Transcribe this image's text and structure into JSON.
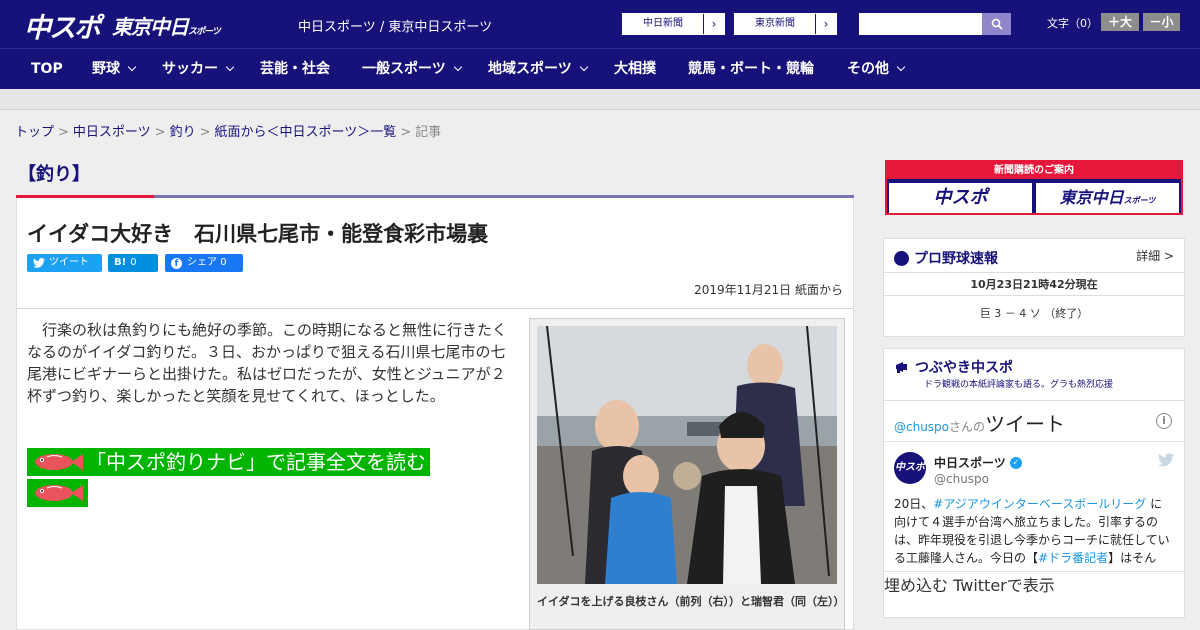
{
  "header": {
    "logo_chunichi_sports": "中スポ",
    "logo_tokyo_chunichi": "東京中日",
    "logo_tokyo_chunichi_sub": "スポーツ",
    "site_links": "中日スポーツ / 東京中日スポーツ",
    "paper_buttons": [
      {
        "label": "中日新聞",
        "arrow": "›"
      },
      {
        "label": "東京新聞",
        "arrow": "›"
      }
    ],
    "search_placeholder": "",
    "font_size_label": "文字（0）",
    "font_larger": "＋大",
    "font_smaller": "－小"
  },
  "nav": {
    "items": [
      {
        "label": "TOP",
        "dropdown": false
      },
      {
        "label": "野球",
        "dropdown": true
      },
      {
        "label": "サッカー",
        "dropdown": true
      },
      {
        "label": "芸能・社会",
        "dropdown": false
      },
      {
        "label": "一般スポーツ",
        "dropdown": true
      },
      {
        "label": "地域スポーツ",
        "dropdown": true
      },
      {
        "label": "大相撲",
        "dropdown": false
      },
      {
        "label": "競馬・ボート・競輪",
        "dropdown": false
      },
      {
        "label": "その他",
        "dropdown": true
      }
    ]
  },
  "breadcrumb": {
    "items": [
      "トップ",
      "中日スポーツ",
      "釣り",
      "紙面から＜中日スポーツ＞一覧",
      "記事"
    ],
    "separator": ">"
  },
  "category": "【釣り】",
  "article": {
    "title": "イイダコ大好き　石川県七尾市・能登食彩市場裏",
    "share": {
      "tweet": "ツイート",
      "hatena_icon": "B!",
      "hatena_count": "0",
      "facebook": "シェア",
      "facebook_count": "0"
    },
    "date": "2019年11月21日 紙面から",
    "body": "行楽の秋は魚釣りにも絶好の季節。この時期になると無性に行きたくなるのがイイダコ釣りだ。３日、おかっぱりで狙える石川県七尾市の七尾港にビギナーらと出掛けた。私はゼロだったが、女性とジュニアが２杯ずつ釣り、楽しかったと笑顔を見せてくれて、ほっとした。",
    "navi_link": "「中スポ釣りナビ」で記事全文を読む",
    "photo_caption": "イイダコを上げる良枝さん（前列（右））と瑞智君（同（左））"
  },
  "sidebar": {
    "ad": {
      "header": "新聞購読のご案内",
      "left": "中スポ",
      "right": "東京中日",
      "right_sub": "スポーツ"
    },
    "baseball": {
      "title": "プロ野球速報",
      "more": "詳細 >",
      "time": "10月23日21時42分現在",
      "score": "巨 3 － 4 ソ （終了）"
    },
    "twitter": {
      "title": "つぶやき中スポ",
      "subtitle": "ドラ観戦の本紙評論家も語る。グラも熱烈応援",
      "handle_at": "@chuspo",
      "handle_suffix": "さんの",
      "heading": "ツイート",
      "info": "i",
      "avatar_text": "中スポ",
      "name": "中日スポーツ",
      "user": "@chuspo",
      "tweet_pre": "20日、",
      "tweet_tag1": "#アジアウインターベースボールリーグ",
      "tweet_mid": " に向けて４選手が台湾へ旅立ちました。引率するのは、昨年現役を引退し今季からコーチに就任している工藤隆人さん。今日の【",
      "tweet_tag2": "#ドラ番記者",
      "tweet_post": "】はそんな“新米",
      "embed": "埋め込む",
      "view_on": "Twitterで表示"
    }
  },
  "colors": {
    "brand_navy": "#17127a",
    "accent_red": "#e5173a",
    "navi_green": "#00b400",
    "twitter_blue": "#1da1f2",
    "hatena_blue": "#008fde",
    "facebook_blue": "#1877f2"
  }
}
